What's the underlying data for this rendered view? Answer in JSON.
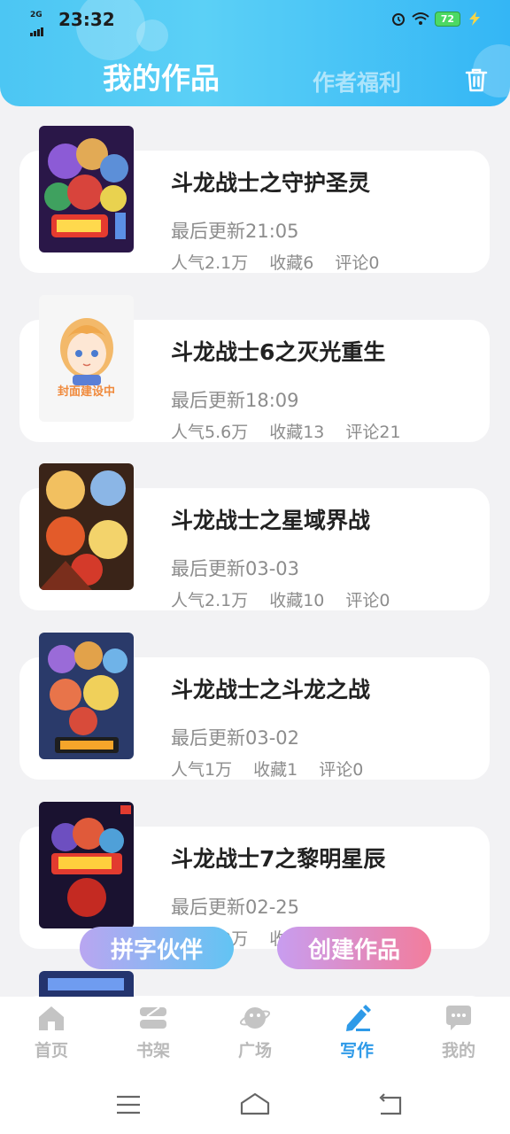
{
  "status_bar": {
    "network": "2G",
    "time": "23:32",
    "battery": "72"
  },
  "header": {
    "active_tab": "我的作品",
    "other_tab": "作者福利"
  },
  "works": [
    {
      "title": "斗龙战士之守护圣灵",
      "updated": "最后更新21:05",
      "popularity": "人气2.1万",
      "favorites": "收藏6",
      "comments": "评论0",
      "cover_caption": ""
    },
    {
      "title": "斗龙战士6之灭光重生",
      "updated": "最后更新18:09",
      "popularity": "人气5.6万",
      "favorites": "收藏13",
      "comments": "评论21",
      "cover_caption": "封面建设中"
    },
    {
      "title": "斗龙战士之星域界战",
      "updated": "最后更新03-03",
      "popularity": "人气2.1万",
      "favorites": "收藏10",
      "comments": "评论0",
      "cover_caption": ""
    },
    {
      "title": "斗龙战士之斗龙之战",
      "updated": "最后更新03-02",
      "popularity": "人气1万",
      "favorites": "收藏1",
      "comments": "评论0",
      "cover_caption": ""
    },
    {
      "title": "斗龙战士7之黎明星辰",
      "updated": "最后更新02-25",
      "popularity": "人气2.3万",
      "favorites": "收藏",
      "comments": "",
      "cover_caption": ""
    }
  ],
  "fab": {
    "left": "拼字伙伴",
    "right": "创建作品"
  },
  "bottom_nav": [
    {
      "label": "首页",
      "icon": "home-icon"
    },
    {
      "label": "书架",
      "icon": "bookshelf-icon"
    },
    {
      "label": "广场",
      "icon": "planet-icon"
    },
    {
      "label": "写作",
      "icon": "pen-icon"
    },
    {
      "label": "我的",
      "icon": "chat-bubble-icon"
    }
  ],
  "colors": {
    "header_blue": "#4cc6f3",
    "active_nav": "#2e9ae8",
    "inactive_nav": "#b9b9b9"
  }
}
